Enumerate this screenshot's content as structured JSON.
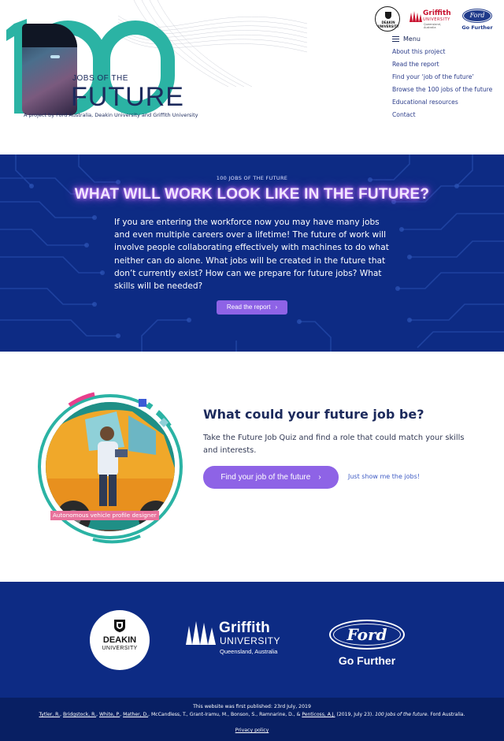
{
  "header": {
    "logo": {
      "numeral": "100",
      "jobs_of_the": "JOBS OF THE",
      "future": "FUTURE"
    },
    "tagline": "A project by Ford Australia, Deakin University and Griffith University",
    "partners": {
      "deakin_name": "DEAKIN",
      "deakin_sub": "UNIVERSITY",
      "griffith_name": "Griffith",
      "griffith_uni": "UNIVERSITY",
      "griffith_loc": "Queensland, Australia",
      "ford_oval": "Ford",
      "ford_tag": "Go Further"
    },
    "menu_label": "Menu",
    "nav": [
      "About this project",
      "Read the report",
      "Find your ‘job of the future’",
      "Browse the 100 jobs of the future",
      "Educational resources",
      "Contact"
    ]
  },
  "hero": {
    "eyebrow": "100 JOBS OF THE FUTURE",
    "title": "WHAT WILL WORK LOOK LIKE IN THE FUTURE?",
    "body": "If you are entering the workforce now you may have many jobs and even multiple careers over a lifetime! The future of work will involve people collaborating effectively with machines to do what neither can do alone. What jobs will be created in the future that don’t currently exist? How can we prepare for future jobs? What skills will be needed?",
    "button_label": "Read the report",
    "button_chevron": "›"
  },
  "quiz": {
    "illustration_caption": "Autonomous vehicle profile designer",
    "title": "What could your future job be?",
    "text": "Take the Future Job Quiz and find a role that could match your skills and interests.",
    "button_label": "Find your job of the future",
    "button_chevron": "›",
    "link_label": "Just show me the jobs!"
  },
  "partners_footer": {
    "deakin_name": "DEAKIN",
    "deakin_sub": "UNIVERSITY",
    "griffith_name": "Griffith",
    "griffith_uni": "UNIVERSITY",
    "griffith_loc": "Queensland, Australia",
    "ford_oval": "Ford",
    "ford_tag": "Go Further"
  },
  "footer": {
    "published": "This website was first published: 23rd July, 2019",
    "citation_authors": [
      "Tytler, R.",
      "Bridgstock, R.",
      "White, P.",
      "Mather, D."
    ],
    "citation_middle": "McCandless, T., Grant-Iramu, M., Bonson, S., Ramnarine, D., &",
    "citation_last_author": "Penticoss, A.J.",
    "citation_year": "(2019, July 23).",
    "citation_title": "100 Jobs of the future.",
    "citation_publisher": "Ford Australia.",
    "privacy": "Privacy policy"
  },
  "colors": {
    "navy": "#0d2b84",
    "teal": "#2bb3a4",
    "purple": "#8e63e6",
    "pink": "#e8739c",
    "griffith_red": "#c8102e"
  },
  "icons": [
    "menu-icon",
    "chevron-right-icon"
  ]
}
